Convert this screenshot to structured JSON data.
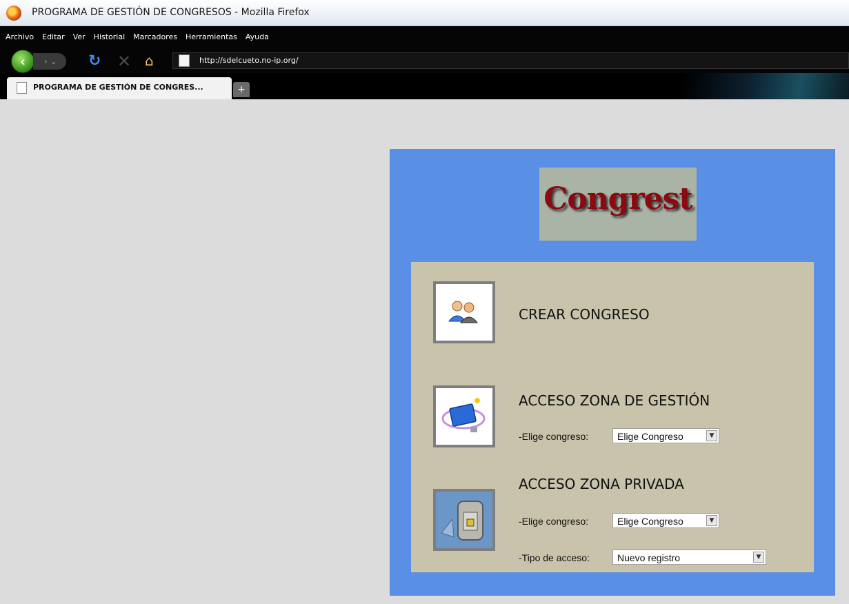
{
  "window": {
    "title": "PROGRAMA DE GESTIÓN DE CONGRESOS - Mozilla Firefox"
  },
  "menu": [
    "Archivo",
    "Editar",
    "Ver",
    "Historial",
    "Marcadores",
    "Herramientas",
    "Ayuda"
  ],
  "navbar": {
    "url": "http://sdelcueto.no-ip.org/"
  },
  "tab": {
    "title": "PROGRAMA DE GESTIÓN DE CONGRES...",
    "new_tab": "+"
  },
  "logo": {
    "text": "Congrest"
  },
  "sections": {
    "crear": {
      "title": "CREAR CONGRESO"
    },
    "gestion": {
      "title": "ACCESO ZONA DE GESTIÓN",
      "congreso_label": "-Elige congreso:",
      "congreso_value": "Elige Congreso"
    },
    "privada": {
      "title": "ACCESO ZONA PRIVADA",
      "congreso_label": "-Elige congreso:",
      "congreso_value": "Elige Congreso",
      "tipo_label": "-Tipo de acceso:",
      "tipo_value": "Nuevo registro"
    }
  },
  "colors": {
    "panel_blue": "#5a8fe6",
    "panel_beige": "#c9c3ab",
    "logo_red": "#8a0a10"
  }
}
